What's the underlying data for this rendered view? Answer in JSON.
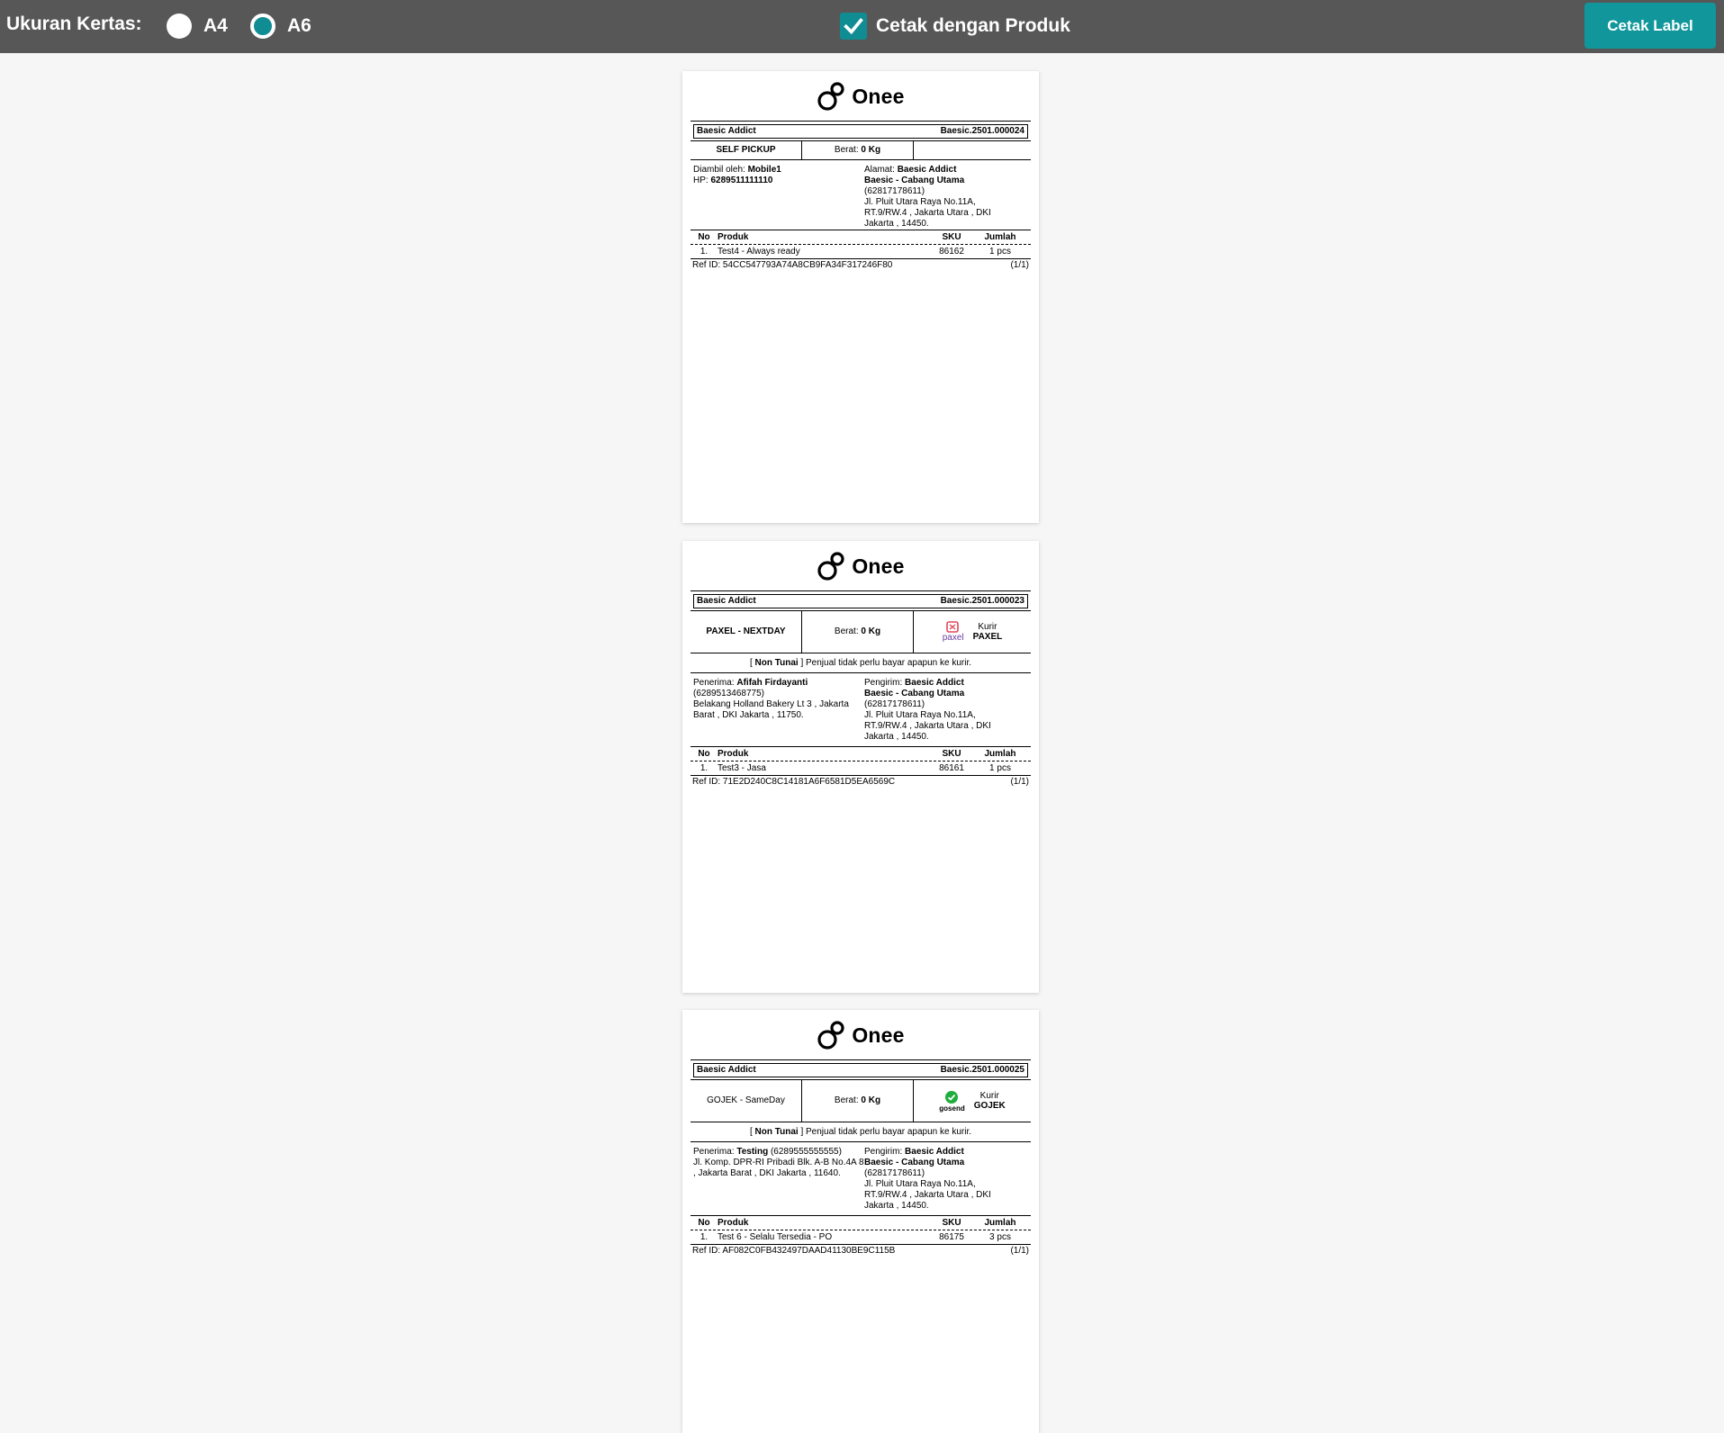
{
  "toolbar": {
    "paper_size_label": "Ukuran Kertas:",
    "options": [
      "A4",
      "A6"
    ],
    "selected": "A6",
    "print_with_products_label": "Cetak dengan Produk",
    "print_with_products_checked": true,
    "print_button_label": "Cetak Label",
    "accent_color": "#10969b"
  },
  "labels": [
    {
      "logo_text": "Onee",
      "shop": "Baesic Addict",
      "order_id": "Baesic.2501.000024",
      "service": "SELF PICKUP",
      "weight_prefix": "Berat:",
      "weight": "0 Kg",
      "left_line1_prefix": "Diambil oleh:",
      "left_line1_value": "Mobile1",
      "left_line2_prefix": "HP:",
      "left_line2_value": "6289511111110",
      "right_prefix": "Alamat:",
      "right_name": "Baesic Addict",
      "right_branch": "Baesic - Cabang Utama",
      "right_phone": "(62817178611)",
      "right_address": "Jl. Pluit Utara Raya No.11A, RT.9/RW.4 , Jakarta Utara , DKI Jakarta , 14450.",
      "col_no": "No",
      "col_product": "Produk",
      "col_sku": "SKU",
      "col_qty": "Jumlah",
      "item_no": "1.",
      "item_name": "Test4 - Always ready",
      "item_sku": "86162",
      "item_qty": "1 pcs",
      "ref": "Ref ID: 54CC547793A74A8CB9FA34F317246F80",
      "page": "(1/1)"
    },
    {
      "logo_text": "Onee",
      "shop": "Baesic Addict",
      "order_id": "Baesic.2501.000023",
      "service": "PAXEL - NEXTDAY",
      "weight_prefix": "Berat:",
      "weight": "0 Kg",
      "courier_brand": "paxel",
      "courier_label": "Kurir",
      "courier_name": "PAXEL",
      "notice_bold": "Non Tunai",
      "notice_rest": "Penjual tidak perlu bayar apapun ke kurir.",
      "left_prefix": "Penerima:",
      "left_name": "Afifah Firdayanti",
      "left_phone": "(6289513468775)",
      "left_address": "Belakang Holland Bakery Lt 3 , Jakarta Barat , DKI Jakarta , 11750.",
      "right_prefix": "Pengirim:",
      "right_name": "Baesic Addict",
      "right_branch": "Baesic - Cabang Utama",
      "right_phone": "(62817178611)",
      "right_address": "Jl. Pluit Utara Raya No.11A, RT.9/RW.4 , Jakarta Utara , DKI Jakarta , 14450.",
      "col_no": "No",
      "col_product": "Produk",
      "col_sku": "SKU",
      "col_qty": "Jumlah",
      "item_no": "1.",
      "item_name": "Test3 - Jasa",
      "item_sku": "86161",
      "item_qty": "1 pcs",
      "ref": "Ref ID: 71E2D240C8C14181A6F6581D5EA6569C",
      "page": "(1/1)"
    },
    {
      "logo_text": "Onee",
      "shop": "Baesic Addict",
      "order_id": "Baesic.2501.000025",
      "service": "GOJEK - SameDay",
      "weight_prefix": "Berat:",
      "weight": "0 Kg",
      "courier_brand": "gosend",
      "courier_label": "Kurir",
      "courier_name": "GOJEK",
      "notice_bold": "Non Tunai",
      "notice_rest": "Penjual tidak perlu bayar apapun ke kurir.",
      "left_prefix": "Penerima:",
      "left_name": "Testing",
      "left_phone": "(6289555555555)",
      "left_address": "Jl. Komp. DPR-RI Pribadi Blk. A-B No.4A 8 , Jakarta Barat , DKI Jakarta , 11640.",
      "right_prefix": "Pengirim:",
      "right_name": "Baesic Addict",
      "right_branch": "Baesic - Cabang Utama",
      "right_phone": "(62817178611)",
      "right_address": "Jl. Pluit Utara Raya No.11A, RT.9/RW.4 , Jakarta Utara , DKI Jakarta , 14450.",
      "col_no": "No",
      "col_product": "Produk",
      "col_sku": "SKU",
      "col_qty": "Jumlah",
      "item_no": "1.",
      "item_name": "Test 6 - Selalu Tersedia - PO",
      "item_sku": "86175",
      "item_qty": "3 pcs",
      "ref": "Ref ID: AF082C0FB432497DAAD41130BE9C115B",
      "page": "(1/1)"
    }
  ]
}
